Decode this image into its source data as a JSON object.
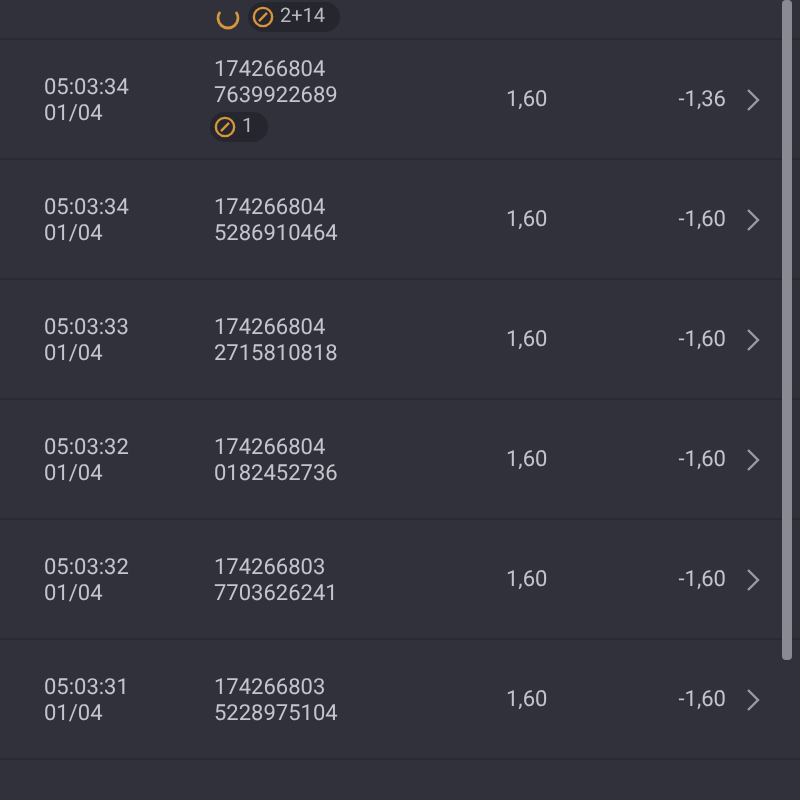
{
  "top_row": {
    "badge": "2+14"
  },
  "rows": [
    {
      "time": "05:03:34",
      "date": "01/04",
      "id_line_1": "174266804",
      "id_line_2": "7639922689",
      "price": "1,60",
      "amount": "-1,36",
      "badge": "1"
    },
    {
      "time": "05:03:34",
      "date": "01/04",
      "id_line_1": "174266804",
      "id_line_2": "5286910464",
      "price": "1,60",
      "amount": "-1,60"
    },
    {
      "time": "05:03:33",
      "date": "01/04",
      "id_line_1": "174266804",
      "id_line_2": "2715810818",
      "price": "1,60",
      "amount": "-1,60"
    },
    {
      "time": "05:03:32",
      "date": "01/04",
      "id_line_1": "174266804",
      "id_line_2": "0182452736",
      "price": "1,60",
      "amount": "-1,60"
    },
    {
      "time": "05:03:32",
      "date": "01/04",
      "id_line_1": "174266803",
      "id_line_2": "7703626241",
      "price": "1,60",
      "amount": "-1,60"
    },
    {
      "time": "05:03:31",
      "date": "01/04",
      "id_line_1": "174266803",
      "id_line_2": "5228975104",
      "price": "1,60",
      "amount": "-1,60"
    }
  ]
}
